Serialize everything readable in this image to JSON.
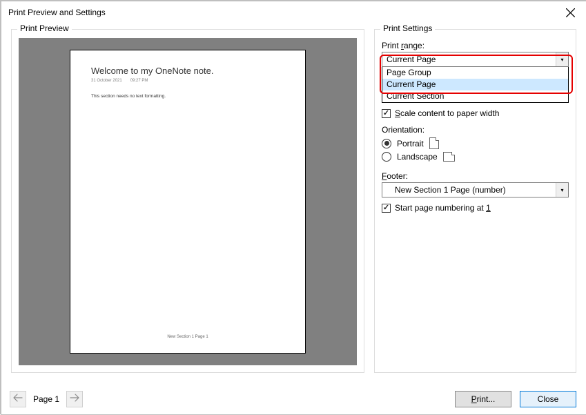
{
  "window": {
    "title": "Print Preview and Settings"
  },
  "preview": {
    "legend": "Print Preview",
    "doc_title": "Welcome to my OneNote note.",
    "doc_date": "31 October 2021",
    "doc_time": "09:27 PM",
    "doc_body": "This section needs no text formatting.",
    "doc_footer": "New Section  1 Page  1"
  },
  "settings": {
    "legend": "Print Settings",
    "range": {
      "label_pre": "Print ",
      "label_under": "r",
      "label_post": "ange:",
      "value": "Current Page",
      "options": [
        "Page Group",
        "Current Page",
        "Current Section"
      ],
      "highlight_index": 1
    },
    "scale": {
      "label": "Scale content to paper width",
      "under": "S",
      "checked": true
    },
    "orientation": {
      "label": "Orientation:",
      "portrait": "Portrait",
      "landscape": "Landscape",
      "selected": "Portrait"
    },
    "footer": {
      "label_pre": "",
      "label_under": "F",
      "label_post": "ooter:",
      "value": "New Section 1 Page (number)"
    },
    "startnum": {
      "label": "Start page numbering at 1",
      "under": "1",
      "checked": true
    }
  },
  "nav": {
    "page_label": "Page 1"
  },
  "buttons": {
    "print_pre": "",
    "print_under": "P",
    "print_post": "rint...",
    "close": "Close"
  }
}
